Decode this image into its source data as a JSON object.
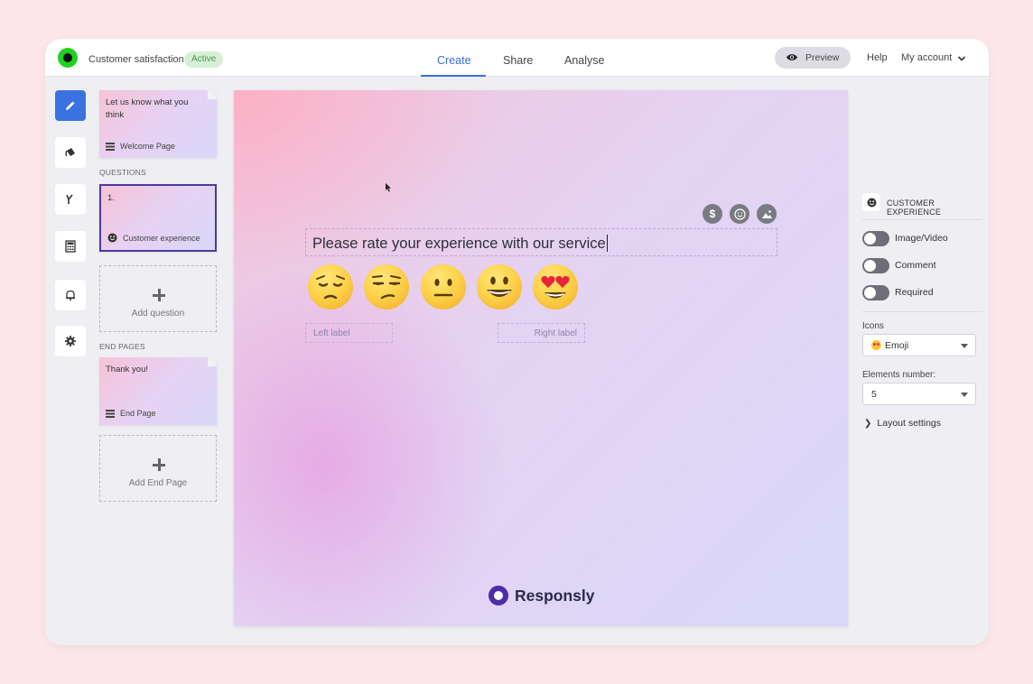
{
  "header": {
    "survey_title": "Customer satisfaction",
    "status": "Active",
    "tabs": [
      "Create",
      "Share",
      "Analyse"
    ],
    "active_tab": "Create",
    "preview_label": "Preview",
    "help_label": "Help",
    "account_label": "My account"
  },
  "rail": {
    "items": [
      "edit-icon",
      "theme-icon",
      "logic-branch-icon",
      "calculator-icon",
      "bell-icon",
      "gear-icon"
    ],
    "active": "edit-icon"
  },
  "pages": {
    "welcome": {
      "text": "Let us know what you think",
      "label": "Welcome Page"
    },
    "questions_header": "QUESTIONS",
    "questions": [
      {
        "number": "1.",
        "label": "Customer experience"
      }
    ],
    "add_question": "Add question",
    "end_header": "END PAGES",
    "end": {
      "text": "Thank you!",
      "label": "End Page"
    },
    "add_end_page": "Add End Page"
  },
  "canvas": {
    "question_text": "Please rate your experience with our service",
    "tool_icons": [
      "dollar-icon",
      "smiley-icon",
      "image-icon"
    ],
    "emojis": [
      "pensive-face",
      "unamused-face",
      "neutral-face",
      "smiling-face",
      "heart-eyes-face"
    ],
    "left_label": "Left label",
    "right_label": "Right label",
    "brand": "Responsly"
  },
  "settings": {
    "section_title": "CUSTOMER EXPERIENCE",
    "toggles": [
      {
        "label": "Image/Video",
        "on": false
      },
      {
        "label": "Comment",
        "on": false
      },
      {
        "label": "Required",
        "on": false
      }
    ],
    "icons_label": "Icons",
    "icons_value": "Emoji",
    "elements_label": "Elements number:",
    "elements_value": "5",
    "layout_settings": "Layout settings"
  },
  "colors": {
    "accent": "#3a72e0",
    "active_badge_bg": "#d6f0d6",
    "brand": "#4b2fa8",
    "selected_border": "#4b3aa0"
  }
}
